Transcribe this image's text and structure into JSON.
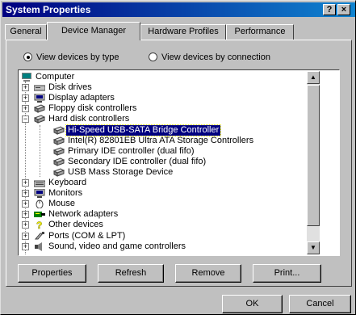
{
  "window": {
    "title": "System Properties",
    "help_btn": "?",
    "close_btn": "×"
  },
  "tabs": [
    {
      "label": "General"
    },
    {
      "label": "Device Manager"
    },
    {
      "label": "Hardware Profiles"
    },
    {
      "label": "Performance"
    }
  ],
  "radios": {
    "by_type": "View devices by type",
    "by_connection": "View devices by connection",
    "selected": "by_type"
  },
  "tree": {
    "root": "Computer",
    "items": [
      {
        "label": "Disk drives",
        "icon": "disk-drive-icon",
        "expanded": false
      },
      {
        "label": "Display adapters",
        "icon": "monitor-icon",
        "expanded": false
      },
      {
        "label": "Floppy disk controllers",
        "icon": "controller-icon",
        "expanded": false
      },
      {
        "label": "Hard disk controllers",
        "icon": "controller-icon",
        "expanded": true
      },
      {
        "label": "Hi-Speed USB-SATA Bridge Controller",
        "icon": "controller-icon",
        "child": true,
        "selected": true
      },
      {
        "label": "Intel(R) 82801EB Ultra ATA Storage Controllers",
        "icon": "controller-icon",
        "child": true
      },
      {
        "label": "Primary IDE controller (dual fifo)",
        "icon": "controller-icon",
        "child": true
      },
      {
        "label": "Secondary IDE controller (dual fifo)",
        "icon": "controller-icon",
        "child": true
      },
      {
        "label": "USB Mass Storage Device",
        "icon": "controller-icon",
        "child": true
      },
      {
        "label": "Keyboard",
        "icon": "keyboard-icon",
        "expanded": false
      },
      {
        "label": "Monitors",
        "icon": "monitor-icon",
        "expanded": false
      },
      {
        "label": "Mouse",
        "icon": "mouse-icon",
        "expanded": false
      },
      {
        "label": "Network adapters",
        "icon": "network-icon",
        "expanded": false
      },
      {
        "label": "Other devices",
        "icon": "question-icon",
        "expanded": false
      },
      {
        "label": "Ports (COM & LPT)",
        "icon": "port-icon",
        "expanded": false
      },
      {
        "label": "Sound, video and game controllers",
        "icon": "sound-icon",
        "expanded": false
      }
    ]
  },
  "buttons": {
    "properties": "Properties",
    "refresh": "Refresh",
    "remove": "Remove",
    "print": "Print...",
    "ok": "OK",
    "cancel": "Cancel"
  },
  "colors": {
    "title_start": "#000080",
    "title_end": "#1084d0",
    "selection": "#000080",
    "face": "#c0c0c0"
  }
}
